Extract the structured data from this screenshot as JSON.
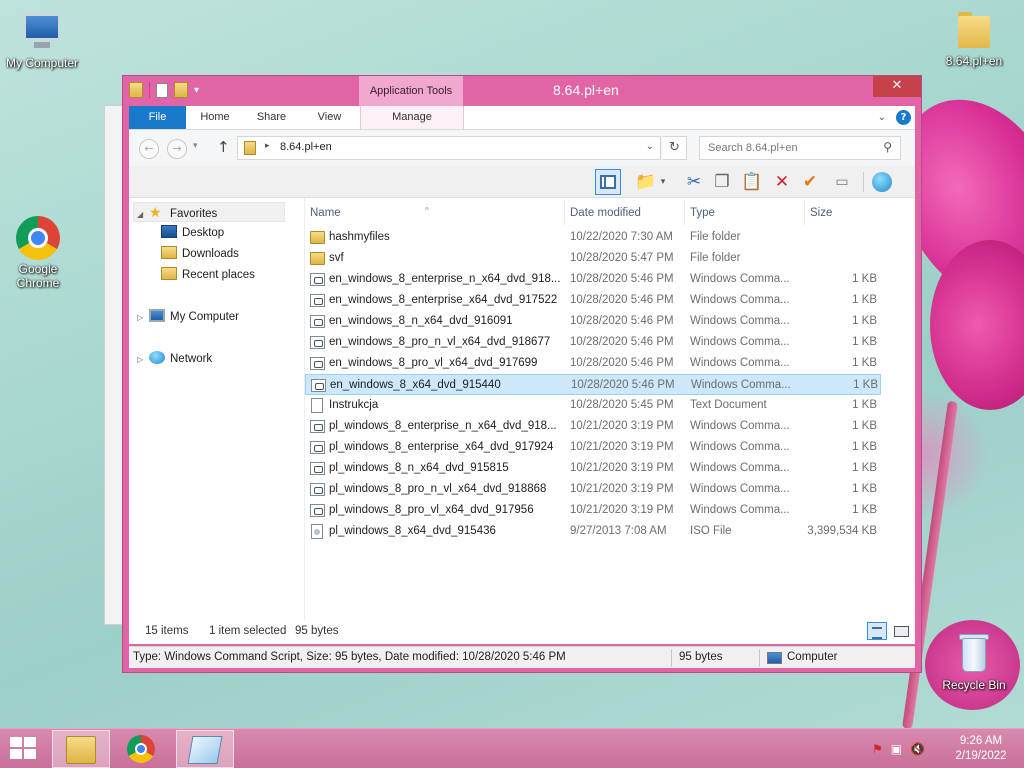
{
  "desktop": {
    "icons": {
      "my_computer": "My Computer",
      "folder": "8.64.pl+en",
      "chrome": "Google Chrome",
      "recycle_bin": "Recycle Bin"
    },
    "colors": {
      "window_frame": "#e165a6",
      "selection": "#cde8fb",
      "taskbar": "#c97098"
    }
  },
  "window": {
    "title": "8.64.pl+en",
    "contextual_tab_group": "Application Tools",
    "close_symbol": "✕",
    "ribbon_tabs": {
      "file": "File",
      "home": "Home",
      "share": "Share",
      "view": "View",
      "manage": "Manage"
    },
    "help_symbol": "?",
    "address": {
      "path": "8.64.pl+en",
      "search_placeholder": "Search 8.64.pl+en"
    },
    "navigation": {
      "favorites": "Favorites",
      "desktop": "Desktop",
      "downloads": "Downloads",
      "recent_places": "Recent places",
      "my_computer": "My Computer",
      "network": "Network"
    },
    "columns": {
      "name": "Name",
      "date_modified": "Date modified",
      "type": "Type",
      "size": "Size"
    },
    "files": [
      {
        "name": "hashmyfiles",
        "date": "10/22/2020 7:30 AM",
        "type": "File folder",
        "size": "",
        "icon": "folder-icon"
      },
      {
        "name": "svf",
        "date": "10/28/2020 5:47 PM",
        "type": "File folder",
        "size": "",
        "icon": "folder-icon"
      },
      {
        "name": "en_windows_8_enterprise_n_x64_dvd_918...",
        "date": "10/28/2020 5:46 PM",
        "type": "Windows Comma...",
        "size": "1 KB",
        "icon": "cmd-script-icon"
      },
      {
        "name": "en_windows_8_enterprise_x64_dvd_917522",
        "date": "10/28/2020 5:46 PM",
        "type": "Windows Comma...",
        "size": "1 KB",
        "icon": "cmd-script-icon"
      },
      {
        "name": "en_windows_8_n_x64_dvd_916091",
        "date": "10/28/2020 5:46 PM",
        "type": "Windows Comma...",
        "size": "1 KB",
        "icon": "cmd-script-icon"
      },
      {
        "name": "en_windows_8_pro_n_vl_x64_dvd_918677",
        "date": "10/28/2020 5:46 PM",
        "type": "Windows Comma...",
        "size": "1 KB",
        "icon": "cmd-script-icon"
      },
      {
        "name": "en_windows_8_pro_vl_x64_dvd_917699",
        "date": "10/28/2020 5:46 PM",
        "type": "Windows Comma...",
        "size": "1 KB",
        "icon": "cmd-script-icon"
      },
      {
        "name": "en_windows_8_x64_dvd_915440",
        "date": "10/28/2020 5:46 PM",
        "type": "Windows Comma...",
        "size": "1 KB",
        "icon": "cmd-script-icon",
        "selected": true
      },
      {
        "name": "Instrukcja",
        "date": "10/28/2020 5:45 PM",
        "type": "Text Document",
        "size": "1 KB",
        "icon": "text-document-icon"
      },
      {
        "name": "pl_windows_8_enterprise_n_x64_dvd_918...",
        "date": "10/21/2020 3:19 PM",
        "type": "Windows Comma...",
        "size": "1 KB",
        "icon": "cmd-script-icon"
      },
      {
        "name": "pl_windows_8_enterprise_x64_dvd_917924",
        "date": "10/21/2020 3:19 PM",
        "type": "Windows Comma...",
        "size": "1 KB",
        "icon": "cmd-script-icon"
      },
      {
        "name": "pl_windows_8_n_x64_dvd_915815",
        "date": "10/21/2020 3:19 PM",
        "type": "Windows Comma...",
        "size": "1 KB",
        "icon": "cmd-script-icon"
      },
      {
        "name": "pl_windows_8_pro_n_vl_x64_dvd_918868",
        "date": "10/21/2020 3:19 PM",
        "type": "Windows Comma...",
        "size": "1 KB",
        "icon": "cmd-script-icon"
      },
      {
        "name": "pl_windows_8_pro_vl_x64_dvd_917956",
        "date": "10/21/2020 3:19 PM",
        "type": "Windows Comma...",
        "size": "1 KB",
        "icon": "cmd-script-icon"
      },
      {
        "name": "pl_windows_8_x64_dvd_915436",
        "date": "9/27/2013 7:08 AM",
        "type": "ISO File",
        "size": "3,399,534 KB",
        "icon": "iso-file-icon"
      }
    ],
    "status": {
      "item_count": "15 items",
      "selection": "1 item selected",
      "selection_size": "95 bytes",
      "details": "Type: Windows Command Script, Size: 95 bytes, Date modified: 10/28/2020 5:46 PM",
      "size": "95 bytes",
      "location": "Computer"
    }
  },
  "taskbar": {
    "time": "9:26 AM",
    "date": "2/19/2022"
  }
}
